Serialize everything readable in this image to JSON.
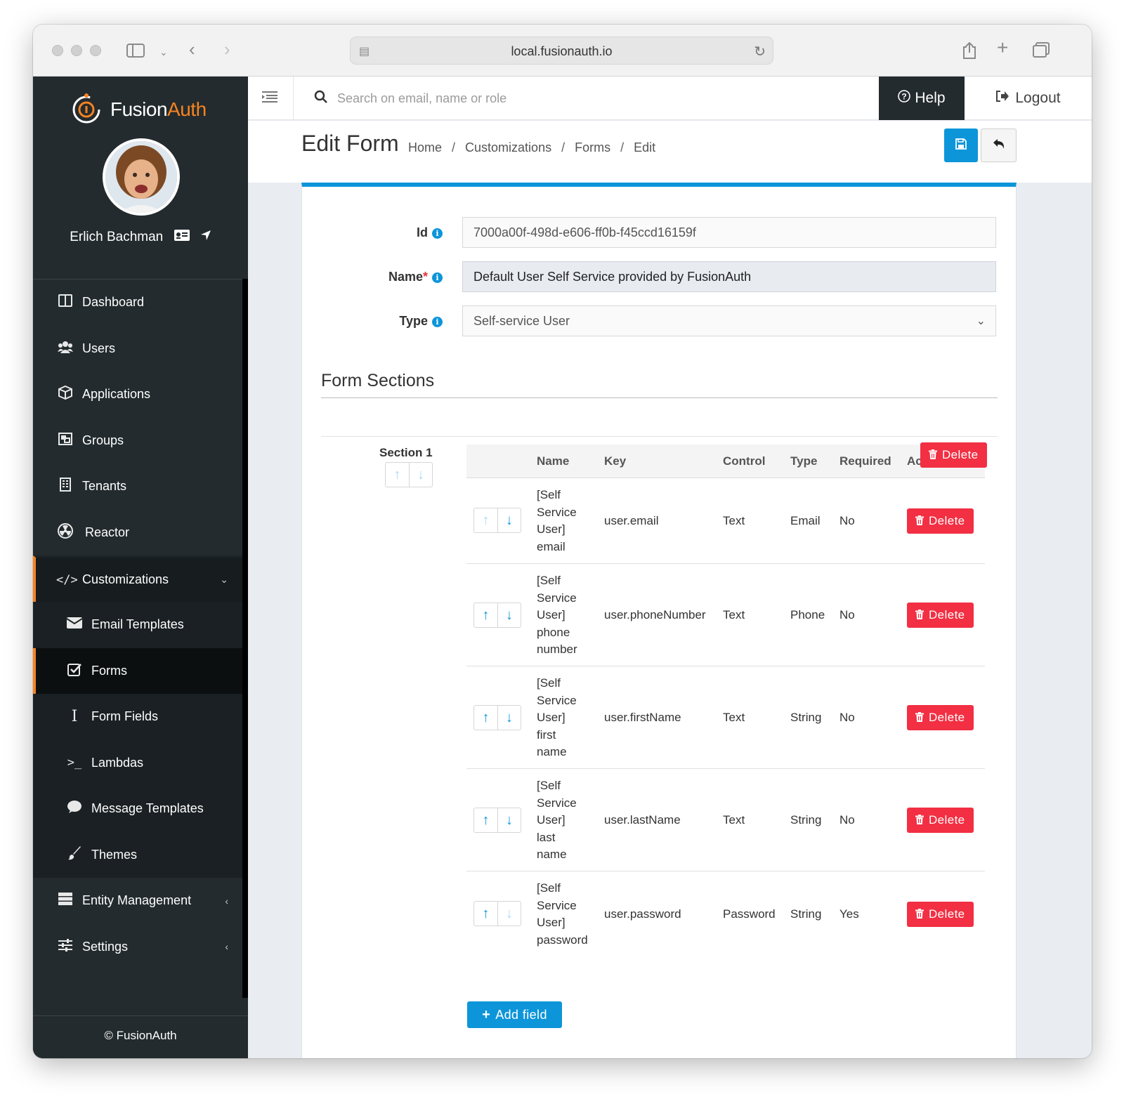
{
  "browser": {
    "url": "local.fusionauth.io"
  },
  "brand": {
    "name_part1": "Fusion",
    "name_part2": "Auth"
  },
  "user": {
    "name": "Erlich Bachman"
  },
  "sidebar": {
    "items": [
      {
        "label": "Dashboard",
        "icon": "columns-icon"
      },
      {
        "label": "Users",
        "icon": "users-icon"
      },
      {
        "label": "Applications",
        "icon": "cube-icon"
      },
      {
        "label": "Groups",
        "icon": "object-group-icon"
      },
      {
        "label": "Tenants",
        "icon": "building-icon"
      },
      {
        "label": "Reactor",
        "icon": "radiation-icon"
      },
      {
        "label": "Customizations",
        "icon": "code-icon"
      },
      {
        "label": "Email Templates",
        "icon": "envelope-icon"
      },
      {
        "label": "Forms",
        "icon": "check-square-icon"
      },
      {
        "label": "Form Fields",
        "icon": "i-cursor-icon"
      },
      {
        "label": "Lambdas",
        "icon": "terminal-icon"
      },
      {
        "label": "Message Templates",
        "icon": "comment-icon"
      },
      {
        "label": "Themes",
        "icon": "paint-brush-icon"
      },
      {
        "label": "Entity Management",
        "icon": "server-icon"
      },
      {
        "label": "Settings",
        "icon": "sliders-icon"
      }
    ],
    "footer": "© FusionAuth"
  },
  "topbar": {
    "search_placeholder": "Search on email, name or role",
    "help_label": "Help",
    "logout_label": "Logout"
  },
  "header": {
    "title": "Edit Form",
    "breadcrumb": [
      "Home",
      "Customizations",
      "Forms",
      "Edit"
    ]
  },
  "form": {
    "id_label": "Id",
    "id_value": "7000a00f-498d-e606-ff0b-f45ccd16159f",
    "name_label": "Name",
    "name_value": "Default User Self Service provided by FusionAuth",
    "type_label": "Type",
    "type_value": "Self-service User"
  },
  "sections": {
    "title": "Form Sections",
    "section_label": "Section 1",
    "columns": [
      "Name",
      "Key",
      "Control",
      "Type",
      "Required",
      "Ac"
    ],
    "delete_label": "Delete",
    "add_field_label": "Add field",
    "rows": [
      {
        "name_lines": [
          "[Self",
          "Service",
          "User]",
          "email"
        ],
        "key": "user.email",
        "control": "Text",
        "type": "Email",
        "required": "No"
      },
      {
        "name_lines": [
          "[Self",
          "Service",
          "User]",
          "phone",
          "number"
        ],
        "key": "user.phoneNumber",
        "control": "Text",
        "type": "Phone",
        "required": "No"
      },
      {
        "name_lines": [
          "[Self",
          "Service",
          "User]",
          "first",
          "name"
        ],
        "key": "user.firstName",
        "control": "Text",
        "type": "String",
        "required": "No"
      },
      {
        "name_lines": [
          "[Self",
          "Service",
          "User]",
          "last",
          "name"
        ],
        "key": "user.lastName",
        "control": "Text",
        "type": "String",
        "required": "No"
      },
      {
        "name_lines": [
          "[Self",
          "Service",
          "User]",
          "password"
        ],
        "key": "user.password",
        "control": "Password",
        "type": "String",
        "required": "Yes"
      }
    ]
  },
  "colors": {
    "accent": "#0d95d9",
    "brand_orange": "#f58320",
    "danger": "#f22f43",
    "sidebar_bg": "#232b2e"
  }
}
